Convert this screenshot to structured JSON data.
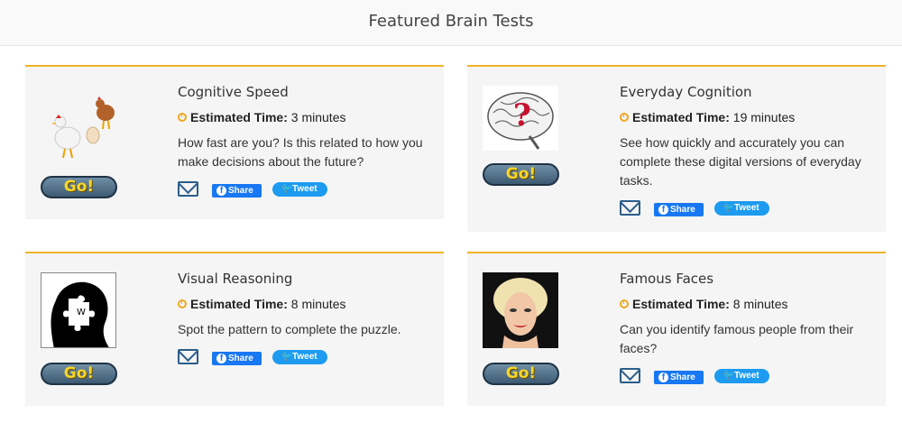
{
  "header": {
    "title": "Featured Brain Tests"
  },
  "tests": [
    {
      "title": "Cognitive Speed",
      "time_label": "Estimated Time:",
      "time_value": " 3 minutes",
      "desc": "How fast are you? Is this related to how you make decisions about the future?",
      "go_label": "Go!",
      "share_label": "Share",
      "tweet_label": "Tweet",
      "image": "chickens-and-egg"
    },
    {
      "title": "Everyday Cognition",
      "time_label": "Estimated Time:",
      "time_value": " 19 minutes",
      "desc": "See how quickly and accurately you can complete these digital versions of everyday tasks.",
      "go_label": "Go!",
      "share_label": "Share",
      "tweet_label": "Tweet",
      "image": "brain-question-mark"
    },
    {
      "title": "Visual Reasoning",
      "time_label": "Estimated Time:",
      "time_value": " 8 minutes",
      "desc": "Spot the pattern to complete the puzzle.",
      "go_label": "Go!",
      "share_label": "Share",
      "tweet_label": "Tweet",
      "image": "puzzle-silhouette"
    },
    {
      "title": "Famous Faces",
      "time_label": "Estimated Time:",
      "time_value": " 8 minutes",
      "desc": "Can you identify famous people from their faces?",
      "go_label": "Go!",
      "share_label": "Share",
      "tweet_label": "Tweet",
      "image": "famous-face-portrait"
    }
  ],
  "colors": {
    "accent": "#f0b429",
    "card_bg": "#f5f5f5",
    "go_text": "#f7d629",
    "facebook": "#1877f2",
    "twitter": "#1d9bf0",
    "mail": "#2a5d8a"
  }
}
